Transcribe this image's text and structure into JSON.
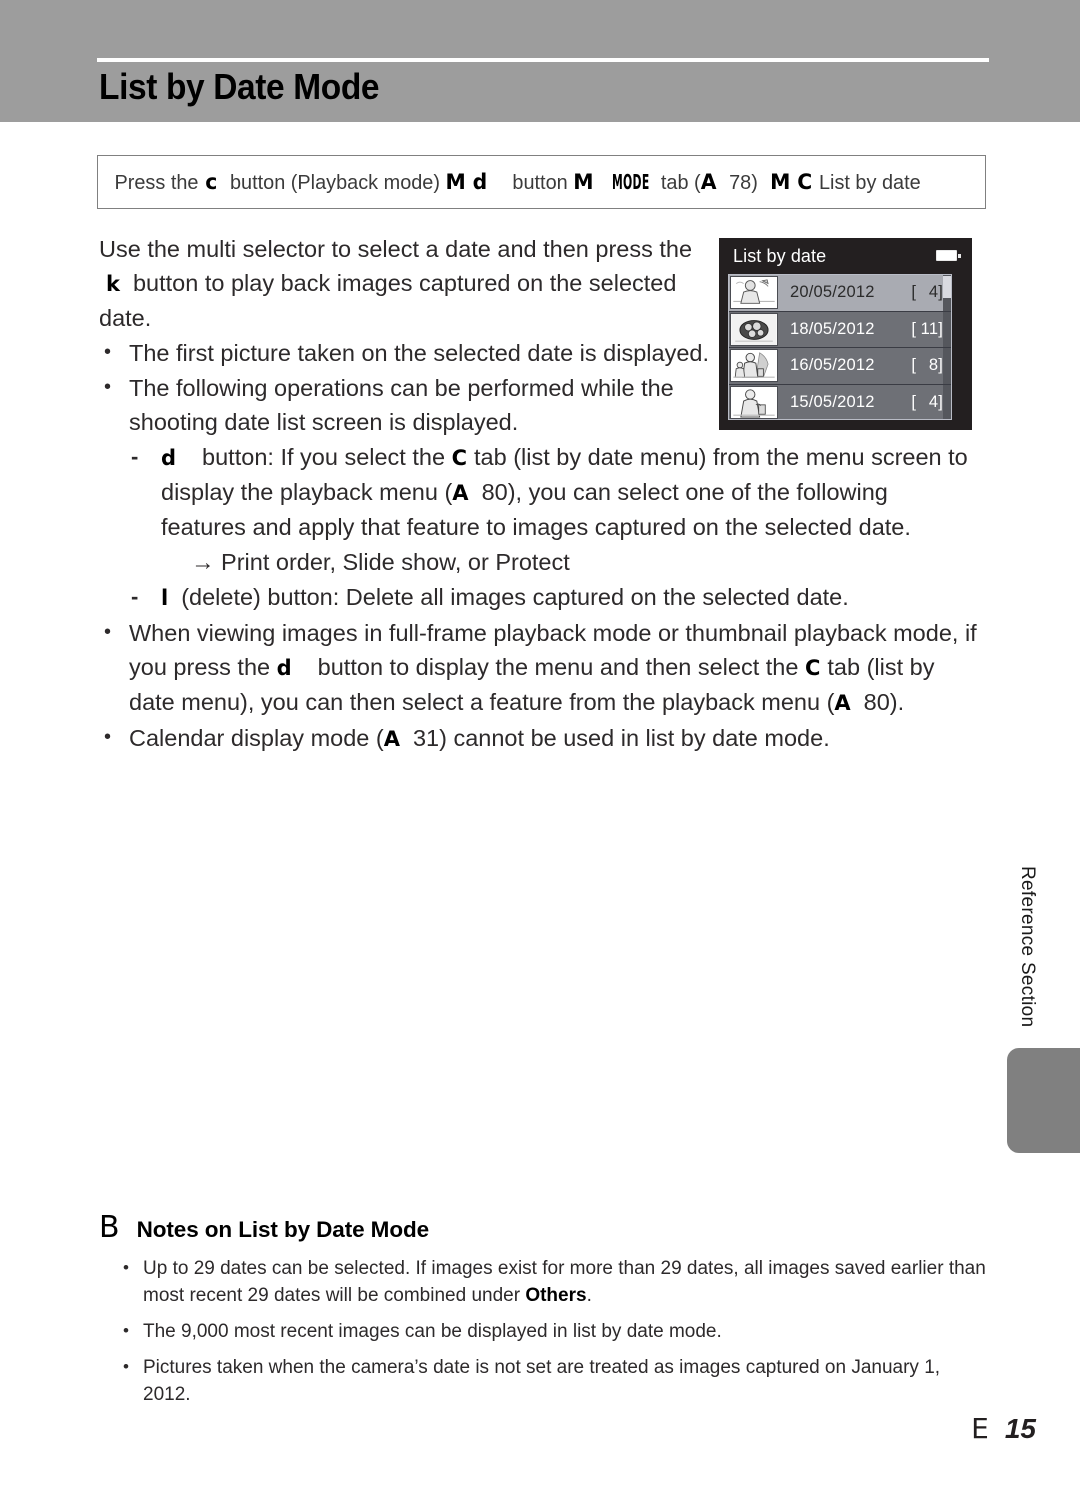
{
  "header": {
    "title": "List by Date Mode"
  },
  "procedure": {
    "press_the": "Press the",
    "playback_glyph": "c",
    "button_playback_mode": "button (Playback mode)",
    "arrow1": "M",
    "menu_glyph": "d",
    "button_label": "button",
    "arrow2": "M",
    "mode_glyph": "MODE",
    "tab_label": "tab (",
    "ref_glyph": "A",
    "ref_page": "78)",
    "arrow3": "M",
    "listdate_glyph": "C",
    "listdate_label": "List by date"
  },
  "intro": {
    "line1": "Use the multi selector to select a date and then press",
    "ok_glyph": "k",
    "line2": "button to play back images captured on the",
    "line3": "selected date.",
    "the_word": "the"
  },
  "bullets": {
    "first_picture": "The first picture taken on the selected date is displayed.",
    "following_ops": "The following operations can be performed while the shooting date list screen is displayed."
  },
  "sub_bullets": {
    "menu_glyph": "d",
    "menu_text_a": "button: If you select the",
    "tab_glyph": "C",
    "menu_text_b": "tab (list by date menu) from the menu screen to display the playback menu (",
    "ref_glyph": "A",
    "ref_page": "80),",
    "menu_text_c": "you can select one of the following features and apply that feature to images captured on the selected date.",
    "arrow_line": "Print order, Slide show, or Protect",
    "delete_glyph": "l",
    "delete_text": "(delete) button: Delete all images captured on the selected date."
  },
  "bullets2": {
    "viewing_a": "When viewing images in full-frame playback mode or thumbnail playback mode, if you press the",
    "menu_glyph": "d",
    "viewing_b": "button to display the menu and then select the",
    "tab_glyph": "C",
    "viewing_c": "tab (list by date menu), you can then select a feature from the playback menu (",
    "ref_glyph": "A",
    "ref_page": "80).",
    "calendar_a": "Calendar display mode (",
    "calendar_ref_glyph": "A",
    "calendar_b": "31) cannot be used in list by date mode."
  },
  "lcd": {
    "title": "List by date",
    "battery_icon": "battery-icon",
    "rows": [
      {
        "date": "20/05/2012",
        "count": "4",
        "selected": true
      },
      {
        "date": "18/05/2012",
        "count": "11",
        "selected": false
      },
      {
        "date": "16/05/2012",
        "count": "8",
        "selected": false
      },
      {
        "date": "15/05/2012",
        "count": "4",
        "selected": false
      }
    ],
    "bracket_open": "[",
    "bracket_close": "]"
  },
  "notes": {
    "mark": "B",
    "title": "Notes on List by Date Mode",
    "items": [
      {
        "pre": "Up to 29 dates can be selected. If images exist for more than 29 dates, all images saved earlier than most recent 29 dates will be combined under ",
        "bold": "Others",
        "post": "."
      },
      {
        "pre": "The 9,000 most recent images can be displayed in list by date mode.",
        "bold": "",
        "post": ""
      },
      {
        "pre": "Pictures taken when the camera’s date is not set are treated as images captured on January 1, 2012.",
        "bold": "",
        "post": ""
      }
    ]
  },
  "sidebar": {
    "section_label": "Reference Section"
  },
  "footer": {
    "prefix": "E",
    "page": "15"
  },
  "colors": {
    "header_band": "#9d9d9d",
    "lcd_background": "#231f20",
    "lcd_row": "#6e7076",
    "lcd_row_selected": "#a9abb2",
    "side_tab": "#808080"
  }
}
